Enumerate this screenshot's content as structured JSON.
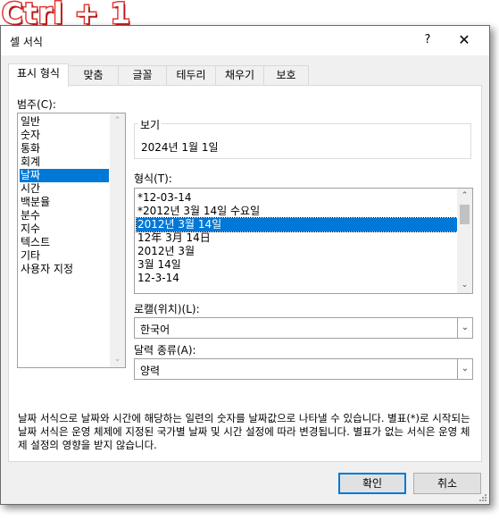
{
  "overlay": {
    "shortcut_label": "Ctrl + 1"
  },
  "window": {
    "title": "셀 서식",
    "help_label": "?",
    "close_label": "✕"
  },
  "tabs": [
    {
      "label": "표시 형식",
      "active": true
    },
    {
      "label": "맞춤"
    },
    {
      "label": "글꼴"
    },
    {
      "label": "테두리"
    },
    {
      "label": "채우기"
    },
    {
      "label": "보호"
    }
  ],
  "category": {
    "label": "범주(C):",
    "items": [
      "일반",
      "숫자",
      "통화",
      "회계",
      "날짜",
      "시간",
      "백분율",
      "분수",
      "지수",
      "텍스트",
      "기타",
      "사용자 지정"
    ],
    "selected": "날짜"
  },
  "sample": {
    "label": "보기",
    "value": "2024년 1월 1일"
  },
  "format": {
    "label": "형식(T):",
    "items": [
      "*12-03-14",
      "*2012년 3월 14일 수요일",
      "2012년 3월 14일",
      "12年 3月 14日",
      "2012년 3월",
      "3월 14일",
      "12-3-14"
    ],
    "selected": "2012년 3월 14일"
  },
  "locale": {
    "label": "로캘(위치)(L):",
    "value": "한국어"
  },
  "calendar": {
    "label": "달력 종류(A):",
    "value": "양력"
  },
  "description": "날짜 서식으로 날짜와 시간에 해당하는 일련의 숫자를 날짜값으로 나타낼 수 있습니다. 별표(*)로 시작되는 날짜 서식은 운영 체제에 지정된 국가별 날짜 및 시간 설정에 따라 변경됩니다. 별표가 없는 서식은 운영 체제 설정의 영향을 받지 않습니다.",
  "buttons": {
    "ok": "확인",
    "cancel": "취소"
  },
  "colors": {
    "accent": "#0078d7",
    "overlay_stroke": "#e53935"
  },
  "icons": {
    "scroll_up": "chevron-up-icon",
    "scroll_down": "chevron-down-icon",
    "dropdown": "chevron-down-icon"
  }
}
